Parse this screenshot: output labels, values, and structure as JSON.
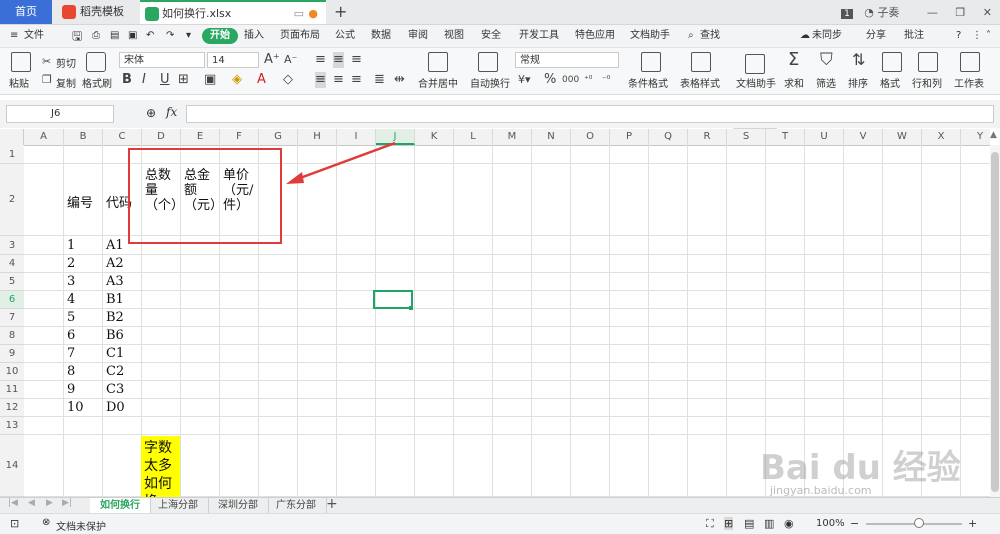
{
  "titlebar": {
    "tabs": [
      {
        "label": "首页"
      },
      {
        "label": "稻壳模板"
      },
      {
        "label": "如何换行.xlsx"
      }
    ],
    "badge": "1",
    "user": "子奏"
  },
  "menubar": {
    "file": "文件",
    "start": "开始",
    "items": [
      "插入",
      "页面布局",
      "公式",
      "数据",
      "审阅",
      "视图",
      "安全",
      "开发工具",
      "特色应用",
      "文档助手"
    ],
    "search": "查找",
    "sync": "未同步",
    "share": "分享",
    "comment": "批注"
  },
  "toolbar": {
    "paste": "粘贴",
    "cut": "剪切",
    "copy": "复制",
    "format_painter": "格式刷",
    "font_name": "宋体",
    "font_size": "14",
    "merge_center": "合并居中",
    "auto_wrap": "自动换行",
    "number_format": "常规",
    "conditional_format": "条件格式",
    "table_style": "表格样式",
    "doc_assistant": "文档助手",
    "sum": "求和",
    "filter": "筛选",
    "sort": "排序",
    "format": "格式",
    "rows_cols": "行和列",
    "worksheet": "工作表"
  },
  "formula": {
    "cell_ref": "J6",
    "fx": "fx",
    "value": ""
  },
  "grid": {
    "columns": [
      "A",
      "B",
      "C",
      "D",
      "E",
      "F",
      "G",
      "H",
      "I",
      "J",
      "K",
      "L",
      "M",
      "N",
      "O",
      "P",
      "Q",
      "R",
      "S",
      "T",
      "U",
      "V",
      "W",
      "X",
      "Y"
    ],
    "rows": [
      "1",
      "2",
      "3",
      "4",
      "5",
      "6",
      "7",
      "8",
      "9",
      "10",
      "11",
      "12",
      "13",
      "14"
    ],
    "header_b2": "编号",
    "header_c2": "代码",
    "header_d2": "总数量（个）",
    "header_e2": "总金额（元）",
    "header_f2": "单价（元/件）",
    "data": [
      {
        "num": "1",
        "code": "A1"
      },
      {
        "num": "2",
        "code": "A2"
      },
      {
        "num": "3",
        "code": "A3"
      },
      {
        "num": "4",
        "code": "B1"
      },
      {
        "num": "5",
        "code": "B2"
      },
      {
        "num": "6",
        "code": "B6"
      },
      {
        "num": "7",
        "code": "C1"
      },
      {
        "num": "8",
        "code": "C2"
      },
      {
        "num": "9",
        "code": "C3"
      },
      {
        "num": "10",
        "code": "D0"
      }
    ],
    "d14": "字数太多如何换"
  },
  "sheets": [
    "如何换行",
    "上海分部",
    "深圳分部",
    "广东分部"
  ],
  "status": {
    "doc_protect": "文档未保护",
    "zoom": "100%"
  },
  "watermark": {
    "brand": "Bai du 经验",
    "url": "jingyan.baidu.com"
  },
  "colors": {
    "accent": "#2aa861",
    "home_tab": "#3b6fd8",
    "annotation": "#e03a3a",
    "highlight": "#ffff00"
  }
}
